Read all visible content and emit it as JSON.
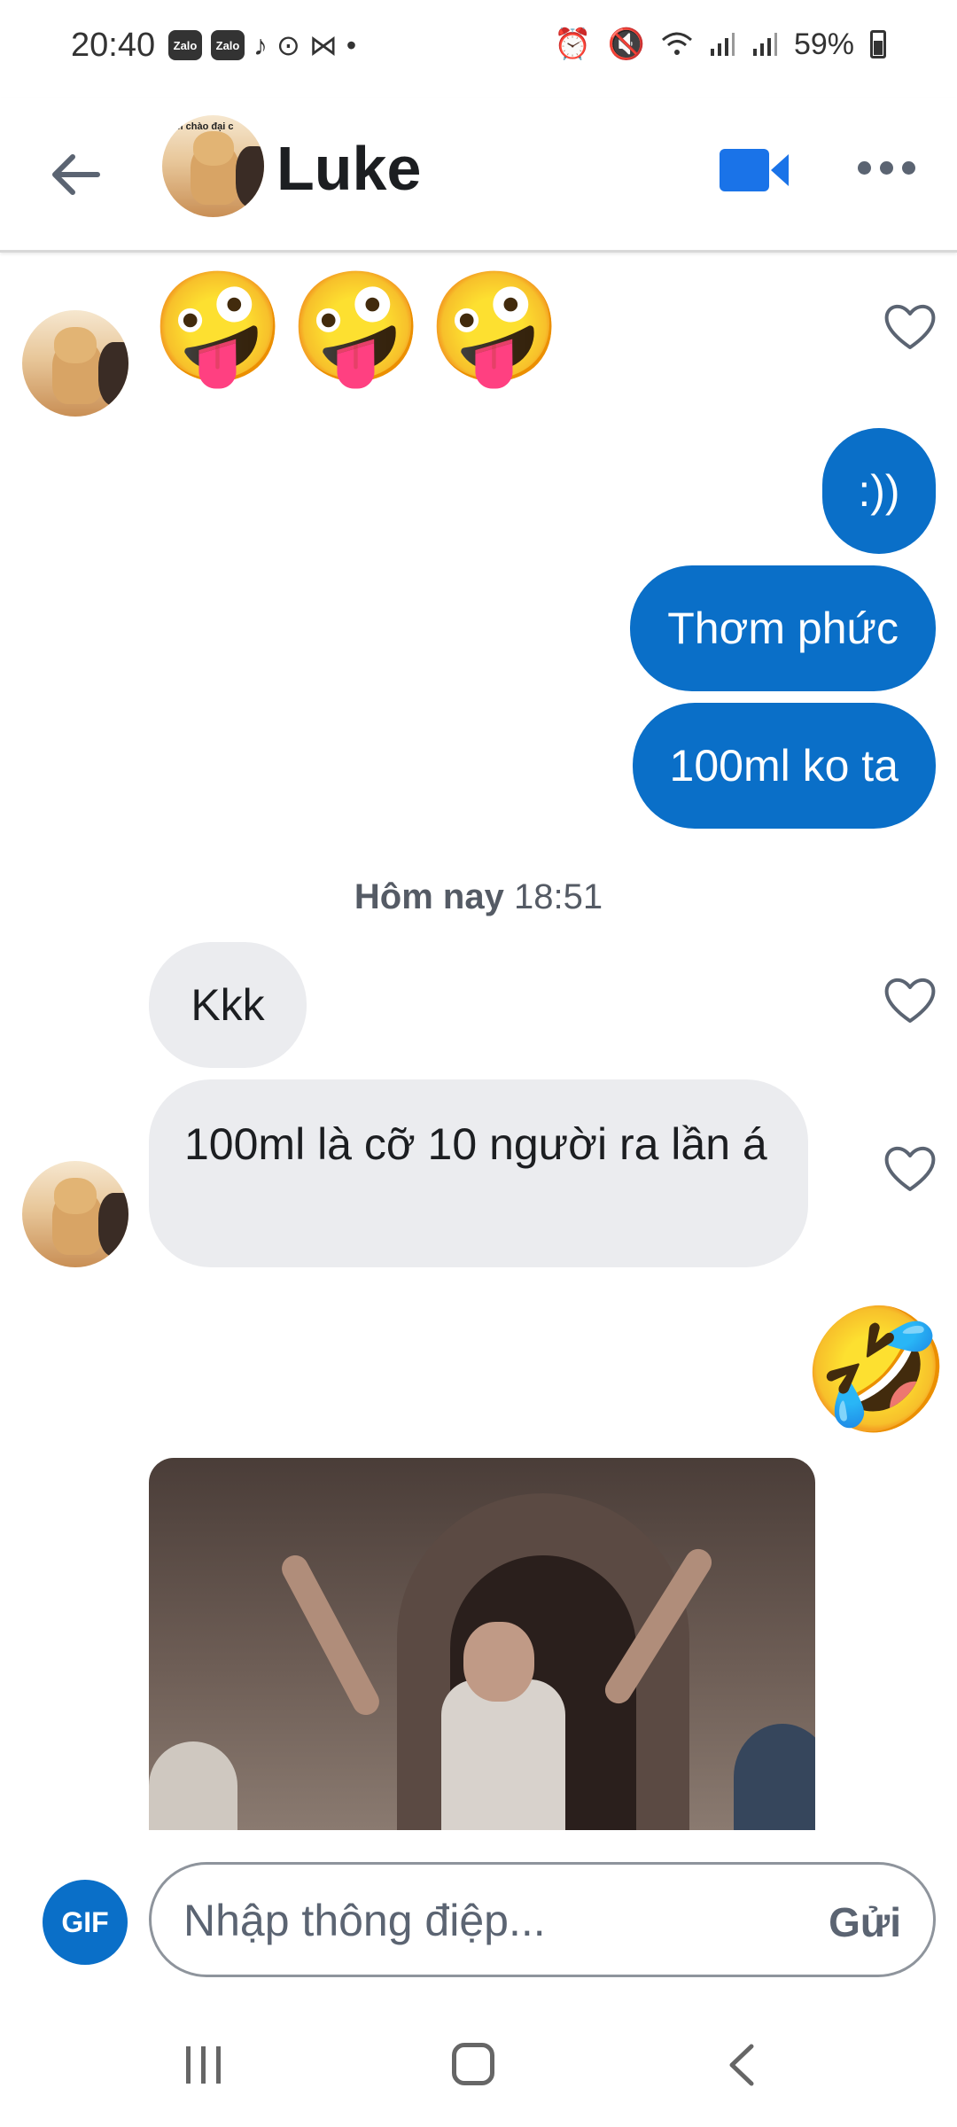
{
  "status_bar": {
    "time": "20:40",
    "app_icons": [
      "Zalo",
      "Zalo",
      "tiktok-icon",
      "camera-icon",
      "capcut-icon"
    ],
    "battery": "59%"
  },
  "header": {
    "contact_name": "Luke",
    "avatar_caption": "m chào đại c"
  },
  "messages": {
    "incoming_emojis": [
      "🤪",
      "🤪",
      "🤪"
    ],
    "out_1": ":))",
    "out_2": "Thơm phức",
    "out_3": "100ml ko ta",
    "timestamp_day": "Hôm nay",
    "timestamp_time": "18:51",
    "in_1": "Kkk",
    "in_2": "100ml là cỡ 10 người ra lần á",
    "outgoing_emoji": "🤣"
  },
  "composer": {
    "gif_label": "GIF",
    "placeholder": "Nhập thông điệp...",
    "send_label": "Gửi"
  },
  "colors": {
    "accent": "#0a6fc8",
    "incoming_bubble": "#ebecef"
  }
}
